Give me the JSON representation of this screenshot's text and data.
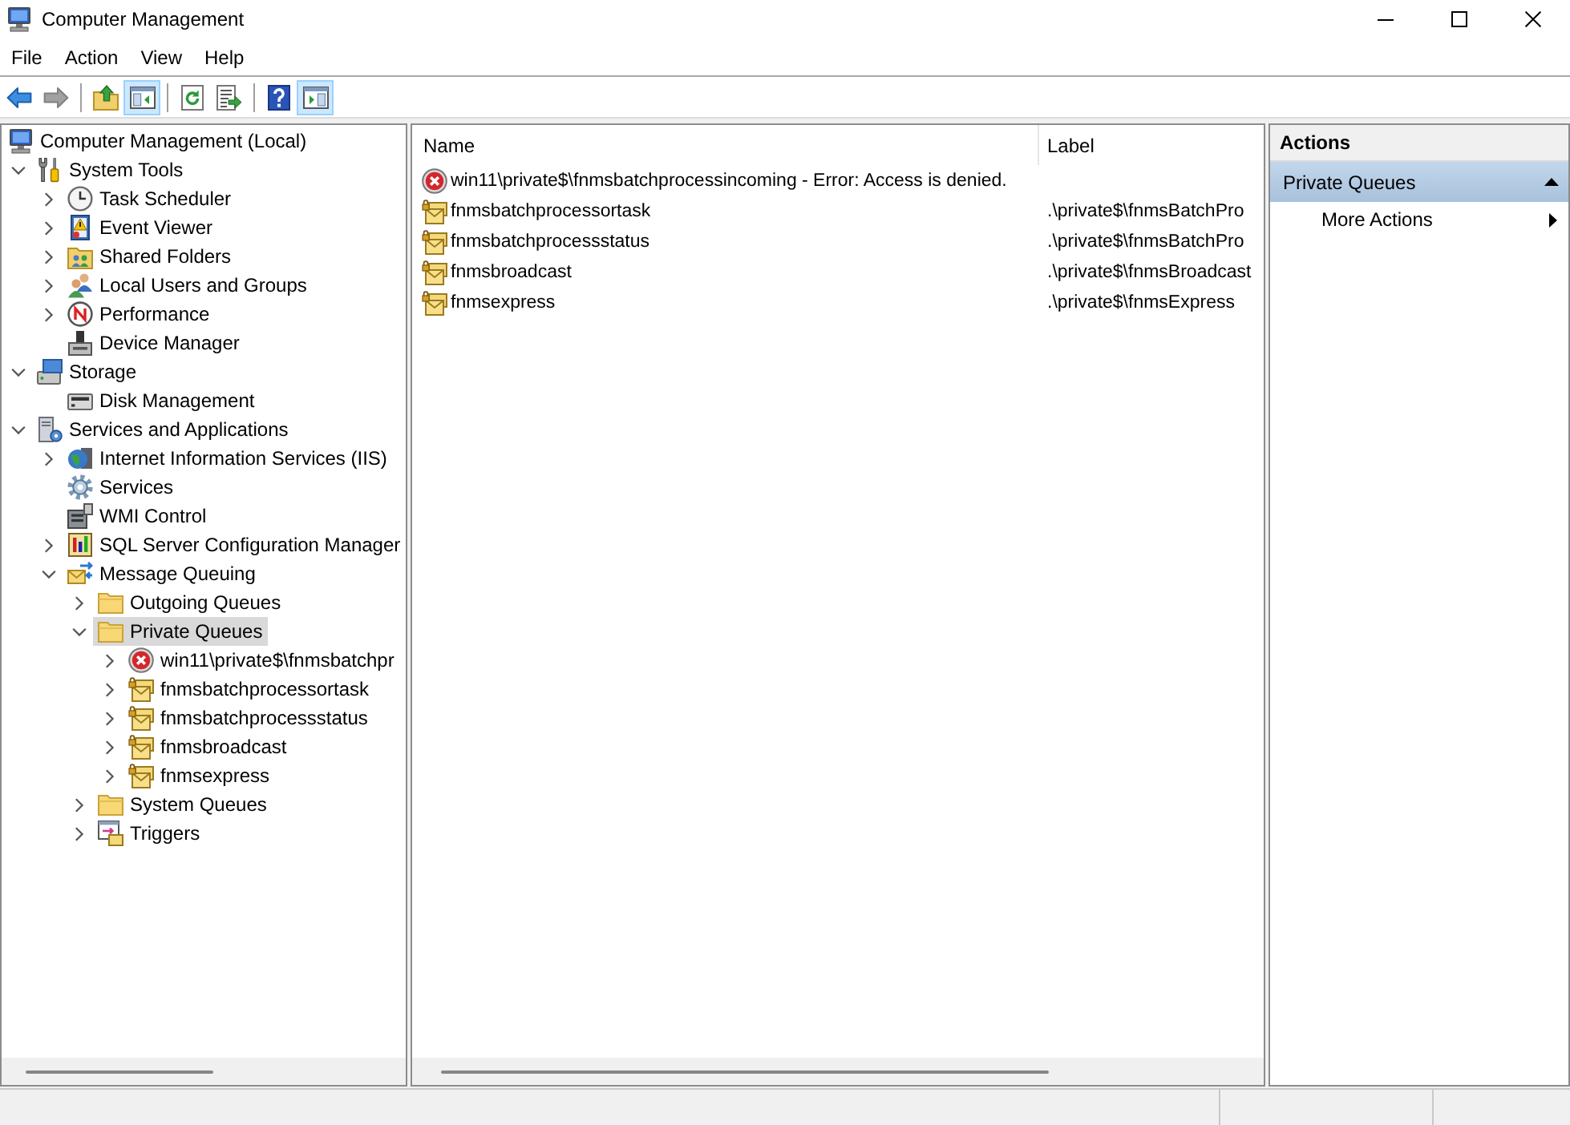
{
  "window": {
    "title": "Computer Management"
  },
  "menu": [
    "File",
    "Action",
    "View",
    "Help"
  ],
  "toolbar": {
    "groups": [
      [
        {
          "kind": "back",
          "pressed": false,
          "disabled": false
        },
        {
          "kind": "forward",
          "pressed": false,
          "disabled": true
        }
      ],
      [
        {
          "kind": "up",
          "pressed": false,
          "disabled": false
        },
        {
          "kind": "show-tree",
          "pressed": true,
          "disabled": false
        }
      ],
      [
        {
          "kind": "refresh",
          "pressed": false,
          "disabled": false
        },
        {
          "kind": "export",
          "pressed": false,
          "disabled": false
        }
      ],
      [
        {
          "kind": "help",
          "pressed": false,
          "disabled": false
        },
        {
          "kind": "show-actions",
          "pressed": true,
          "disabled": false
        }
      ]
    ]
  },
  "tree": {
    "items": [
      {
        "label": "Computer Management (Local)",
        "kind": "computer",
        "selected": false,
        "children": [
          {
            "label": "System Tools",
            "kind": "tools",
            "expanded": true,
            "selected": false,
            "children": [
              {
                "label": "Task Scheduler",
                "kind": "scheduler",
                "expanded": false,
                "selected": false
              },
              {
                "label": "Event Viewer",
                "kind": "event-log",
                "expanded": false,
                "selected": false
              },
              {
                "label": "Shared Folders",
                "kind": "shared-folders",
                "expanded": false,
                "selected": false
              },
              {
                "label": "Local Users and Groups",
                "kind": "users",
                "expanded": false,
                "selected": false
              },
              {
                "label": "Performance",
                "kind": "performance",
                "expanded": false,
                "selected": false
              },
              {
                "label": "Device Manager",
                "kind": "devices",
                "selected": false
              }
            ]
          },
          {
            "label": "Storage",
            "kind": "storage",
            "expanded": true,
            "selected": false,
            "children": [
              {
                "label": "Disk Management",
                "kind": "disk",
                "selected": false
              }
            ]
          },
          {
            "label": "Services and Applications",
            "kind": "services-apps",
            "expanded": true,
            "selected": false,
            "children": [
              {
                "label": "Internet Information Services (IIS)",
                "kind": "iis",
                "expanded": false,
                "selected": false
              },
              {
                "label": "Services",
                "kind": "services",
                "selected": false
              },
              {
                "label": "WMI Control",
                "kind": "wmi",
                "selected": false
              },
              {
                "label": "SQL Server Configuration Manager",
                "kind": "sql-config",
                "expanded": false,
                "selected": false
              },
              {
                "label": "Message Queuing",
                "kind": "message-queuing",
                "expanded": true,
                "selected": false,
                "children": [
                  {
                    "label": "Outgoing Queues",
                    "kind": "folder",
                    "expanded": false,
                    "selected": false
                  },
                  {
                    "label": "Private Queues",
                    "kind": "folder",
                    "expanded": true,
                    "selected": true,
                    "children": [
                      {
                        "label": "win11\\private$\\fnmsbatchpr",
                        "kind": "error-queue",
                        "expanded": false,
                        "selected": false
                      },
                      {
                        "label": "fnmsbatchprocessortask",
                        "kind": "queue",
                        "expanded": false,
                        "selected": false
                      },
                      {
                        "label": "fnmsbatchprocessstatus",
                        "kind": "queue",
                        "expanded": false,
                        "selected": false
                      },
                      {
                        "label": "fnmsbroadcast",
                        "kind": "queue",
                        "expanded": false,
                        "selected": false
                      },
                      {
                        "label": "fnmsexpress",
                        "kind": "queue",
                        "expanded": false,
                        "selected": false
                      }
                    ]
                  },
                  {
                    "label": "System Queues",
                    "kind": "folder",
                    "expanded": false,
                    "selected": false
                  },
                  {
                    "label": "Triggers",
                    "kind": "triggers",
                    "expanded": false,
                    "selected": false
                  }
                ]
              }
            ]
          }
        ]
      }
    ]
  },
  "list": {
    "columns": [
      "Name",
      "Label"
    ],
    "rows": [
      {
        "kind": "error-queue",
        "name": "win11\\private$\\fnmsbatchprocessincoming - Error: Access is denied."
      },
      {
        "kind": "queue",
        "name": "fnmsbatchprocessortask",
        "label": ".\\private$\\fnmsBatchPro"
      },
      {
        "kind": "queue",
        "name": "fnmsbatchprocessstatus",
        "label": ".\\private$\\fnmsBatchPro"
      },
      {
        "kind": "queue",
        "name": "fnmsbroadcast",
        "label": ".\\private$\\fnmsBroadcast"
      },
      {
        "kind": "queue",
        "name": "fnmsexpress",
        "label": ".\\private$\\fnmsExpress"
      }
    ]
  },
  "actions": {
    "title": "Actions",
    "sections": [
      {
        "title": "Private Queues",
        "expanded": true,
        "items": [
          {
            "label": "More Actions",
            "submenu": true
          }
        ]
      }
    ]
  }
}
